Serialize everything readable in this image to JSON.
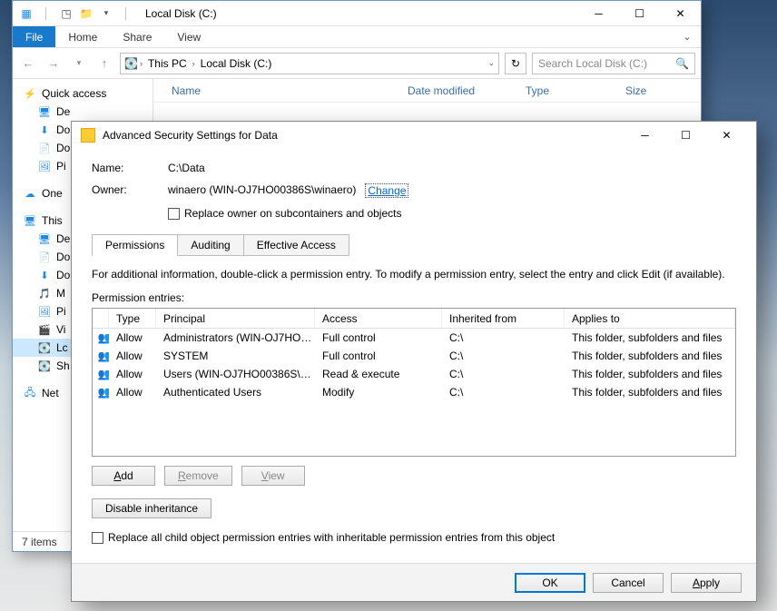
{
  "explorer": {
    "title": "Local Disk (C:)",
    "tabs": {
      "file": "File",
      "home": "Home",
      "share": "Share",
      "view": "View"
    },
    "breadcrumbs": {
      "pc": "This PC",
      "drive": "Local Disk (C:)"
    },
    "search_placeholder": "Search Local Disk (C:)",
    "columns": {
      "name": "Name",
      "date": "Date modified",
      "type": "Type",
      "size": "Size"
    },
    "status": "7 items",
    "tree": {
      "quick": "Quick access",
      "items1": [
        "De",
        "Do",
        "Do",
        "Pi"
      ],
      "onedrive": "One",
      "thispc": "This",
      "items2": [
        "De",
        "Do",
        "Do",
        "M",
        "Pi",
        "Vi"
      ],
      "ldc": "Lc",
      "sh": "Sh",
      "net": "Net"
    }
  },
  "dialog": {
    "title": "Advanced Security Settings for Data",
    "name_label": "Name:",
    "name_value": "C:\\Data",
    "owner_label": "Owner:",
    "owner_value": "winaero (WIN-OJ7HO00386S\\winaero)",
    "change": "Change",
    "replace_owner": "Replace owner on subcontainers and objects",
    "tabs": {
      "perm": "Permissions",
      "audit": "Auditing",
      "eff": "Effective Access"
    },
    "info": "For additional information, double-click a permission entry. To modify a permission entry, select the entry and click Edit (if available).",
    "perm_label": "Permission entries:",
    "columns": {
      "type": "Type",
      "principal": "Principal",
      "access": "Access",
      "inh": "Inherited from",
      "applies": "Applies to"
    },
    "rows": [
      {
        "type": "Allow",
        "principal": "Administrators (WIN-OJ7HO0…",
        "access": "Full control",
        "inh": "C:\\",
        "applies": "This folder, subfolders and files"
      },
      {
        "type": "Allow",
        "principal": "SYSTEM",
        "access": "Full control",
        "inh": "C:\\",
        "applies": "This folder, subfolders and files"
      },
      {
        "type": "Allow",
        "principal": "Users (WIN-OJ7HO00386S\\Us…",
        "access": "Read & execute",
        "inh": "C:\\",
        "applies": "This folder, subfolders and files"
      },
      {
        "type": "Allow",
        "principal": "Authenticated Users",
        "access": "Modify",
        "inh": "C:\\",
        "applies": "This folder, subfolders and files"
      }
    ],
    "buttons": {
      "add": "Add",
      "remove": "Remove",
      "view": "View",
      "disable": "Disable inheritance"
    },
    "replace_all": "Replace all child object permission entries with inheritable permission entries from this object",
    "ok": "OK",
    "cancel": "Cancel",
    "apply": "Apply"
  }
}
